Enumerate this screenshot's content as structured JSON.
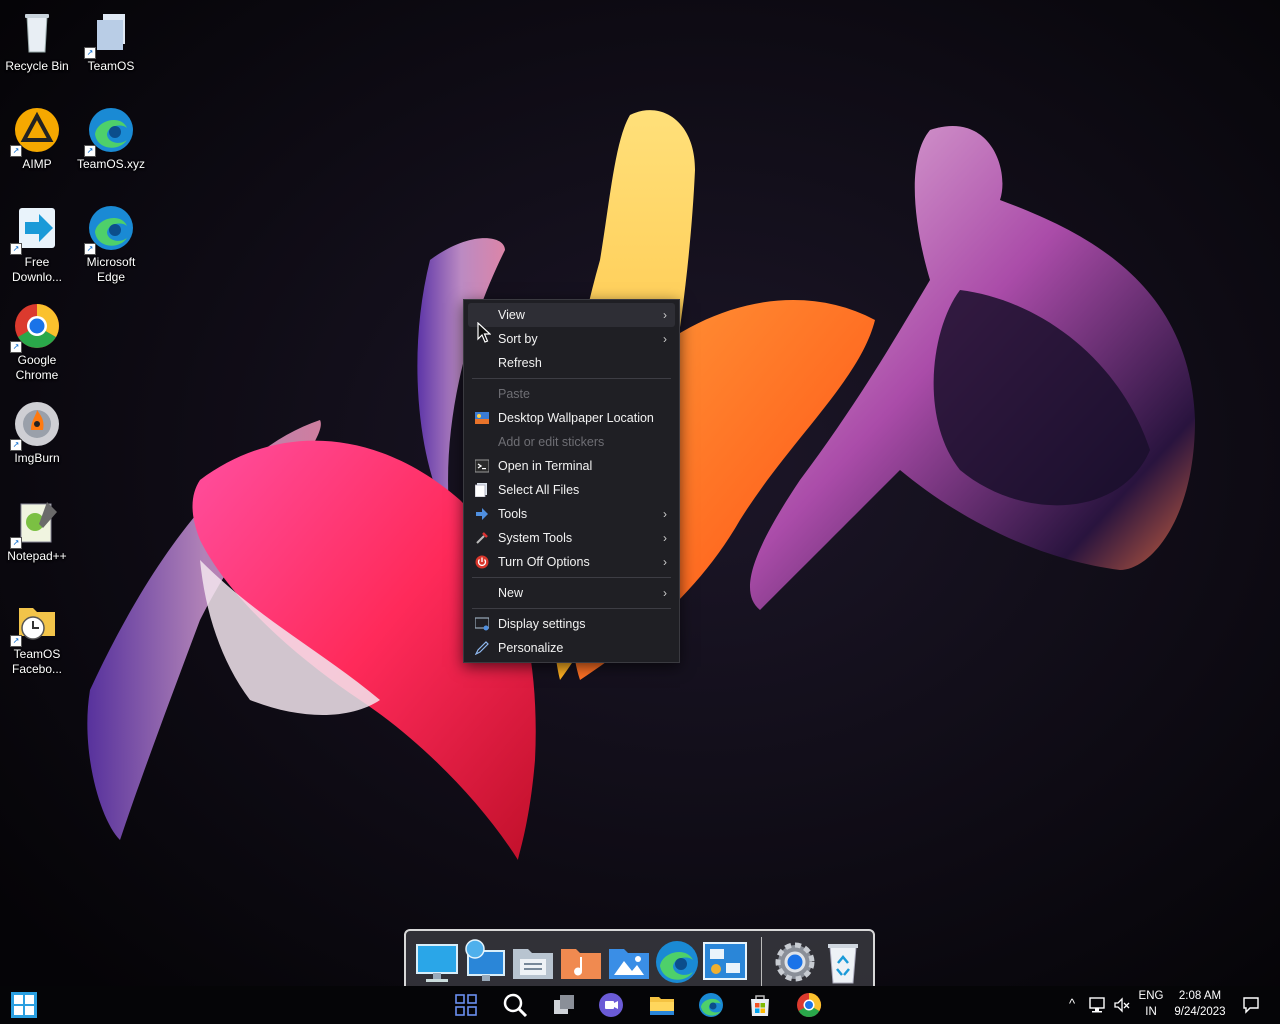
{
  "desktop_icons": [
    {
      "label": "Recycle Bin",
      "icon": "recycle-bin-icon"
    },
    {
      "label": "TeamOS",
      "icon": "folder-icon"
    },
    {
      "label": "AIMP",
      "icon": "aimp-icon"
    },
    {
      "label": "TeamOS.xyz",
      "icon": "edge-icon"
    },
    {
      "label": "Free Downlo...",
      "icon": "free-download-manager-icon"
    },
    {
      "label": "Microsoft Edge",
      "icon": "edge-icon"
    },
    {
      "label": "Google Chrome",
      "icon": "chrome-icon"
    },
    {
      "label": "ImgBurn",
      "icon": "imgburn-icon"
    },
    {
      "label": "Notepad++",
      "icon": "notepad-plus-plus-icon"
    },
    {
      "label": "TeamOS Facebo...",
      "icon": "folder-clock-icon"
    }
  ],
  "context_menu": {
    "items": [
      {
        "label": "View",
        "submenu": true
      },
      {
        "label": "Sort by",
        "submenu": true
      },
      {
        "label": "Refresh"
      },
      {
        "label": "Paste",
        "disabled": true
      },
      {
        "label": "Desktop Wallpaper Location"
      },
      {
        "label": "Add or edit stickers",
        "disabled": true
      },
      {
        "label": "Open in Terminal"
      },
      {
        "label": "Select All Files"
      },
      {
        "label": "Tools",
        "submenu": true
      },
      {
        "label": "System Tools",
        "submenu": true
      },
      {
        "label": "Turn Off Options",
        "submenu": true
      },
      {
        "label": "New",
        "submenu": true
      },
      {
        "label": "Display settings"
      },
      {
        "label": "Personalize"
      }
    ],
    "arrow": "›"
  },
  "tray": {
    "language_top": "ENG",
    "language_bottom": "IN",
    "time": "2:08 AM",
    "date": "9/24/2023",
    "chevron": "^"
  }
}
